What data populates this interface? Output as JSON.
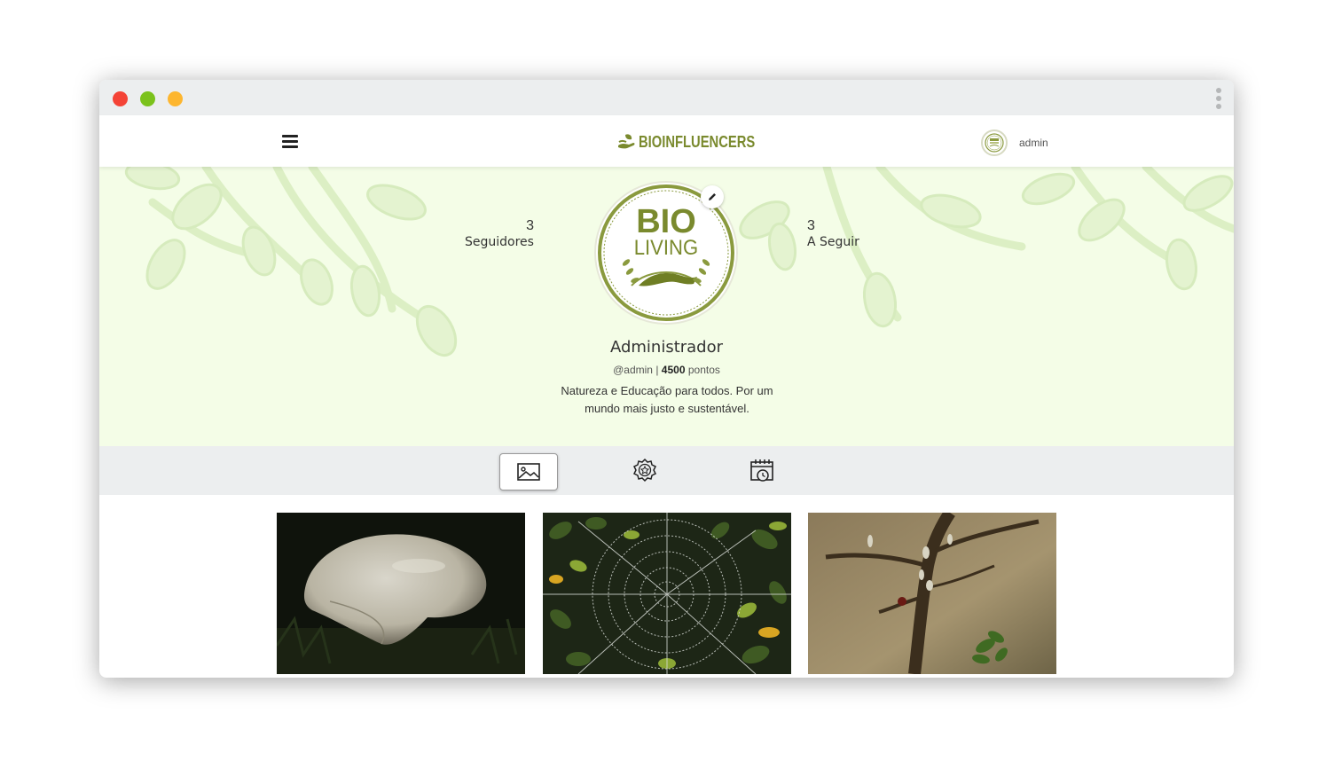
{
  "window": {
    "controls": [
      "close-dot",
      "minimize-dot",
      "maximize-dot"
    ]
  },
  "navbar": {
    "menu_icon": "hamburger-menu-icon",
    "brand_text": "BIOINFLUENCERS",
    "username": "admin"
  },
  "profile": {
    "followers_count": "3",
    "followers_label": "Seguidores",
    "following_count": "3",
    "following_label": "A Seguir",
    "logo_text_top": "BIO",
    "logo_text_bottom": "LIVING",
    "name": "Administrador",
    "handle": "@admin",
    "separator": "|",
    "points": "4500",
    "points_label": "pontos",
    "bio": "Natureza e Educação para todos. Por um mundo mais justo e sustentável."
  },
  "tabs": [
    {
      "icon": "image-icon",
      "active": true
    },
    {
      "icon": "badge-award-icon",
      "active": false
    },
    {
      "icon": "calendar-clock-icon",
      "active": false
    }
  ],
  "gallery": [
    {
      "subject": "mushroom"
    },
    {
      "subject": "spider-web"
    },
    {
      "subject": "thorny-branch"
    }
  ],
  "colors": {
    "brand_olive": "#7a8a2e",
    "hero_bg": "#f4fde7",
    "tab_bar_bg": "#eceeef",
    "close": "#f44336",
    "minimize": "#7bc21c",
    "maximize": "#fdb62f"
  }
}
